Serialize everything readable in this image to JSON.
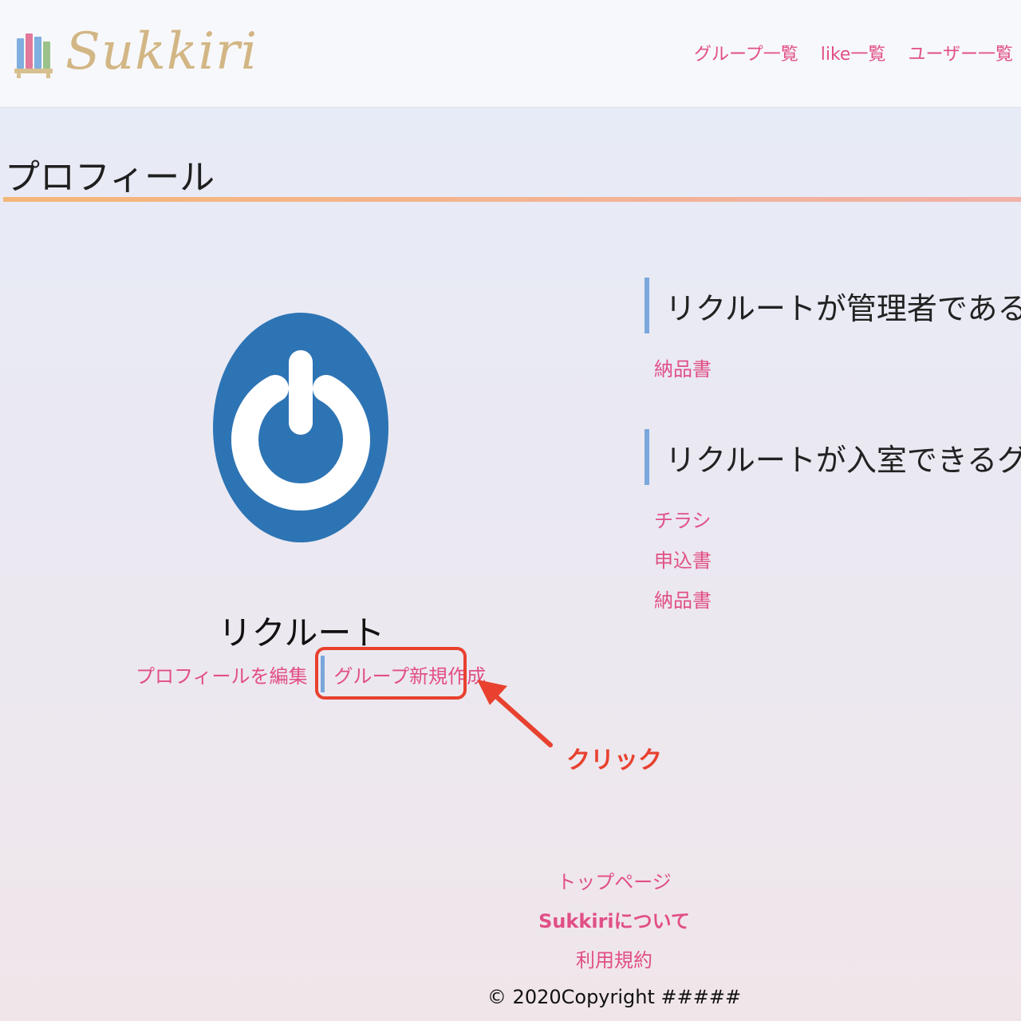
{
  "brand": {
    "name": "Sukkiri"
  },
  "nav": [
    "グループ一覧",
    "like一覧",
    "ユーザー一覧"
  ],
  "page": {
    "title": "プロフィール"
  },
  "profile": {
    "name": "リクルート",
    "edit_label": "プロフィールを編集",
    "create_group_label": "グループ新規作成"
  },
  "annotation": {
    "click_label": "クリック",
    "color": "#e8412f"
  },
  "sections": {
    "admin": {
      "heading": "リクルートが管理者であるグル",
      "items": [
        "納品書"
      ]
    },
    "member": {
      "heading": "リクルートが入室できるグルー",
      "items": [
        "チラシ",
        "申込書",
        "納品書"
      ]
    }
  },
  "footer": {
    "links": [
      "トップページ",
      "Sukkiriについて",
      "利用規約"
    ],
    "copyright": "© 2020Copyright #####"
  },
  "colors": {
    "accent": "#e14f86",
    "logo": "#d2b684",
    "avatar": "#2d74b4",
    "divider": "#7aa7dc"
  }
}
